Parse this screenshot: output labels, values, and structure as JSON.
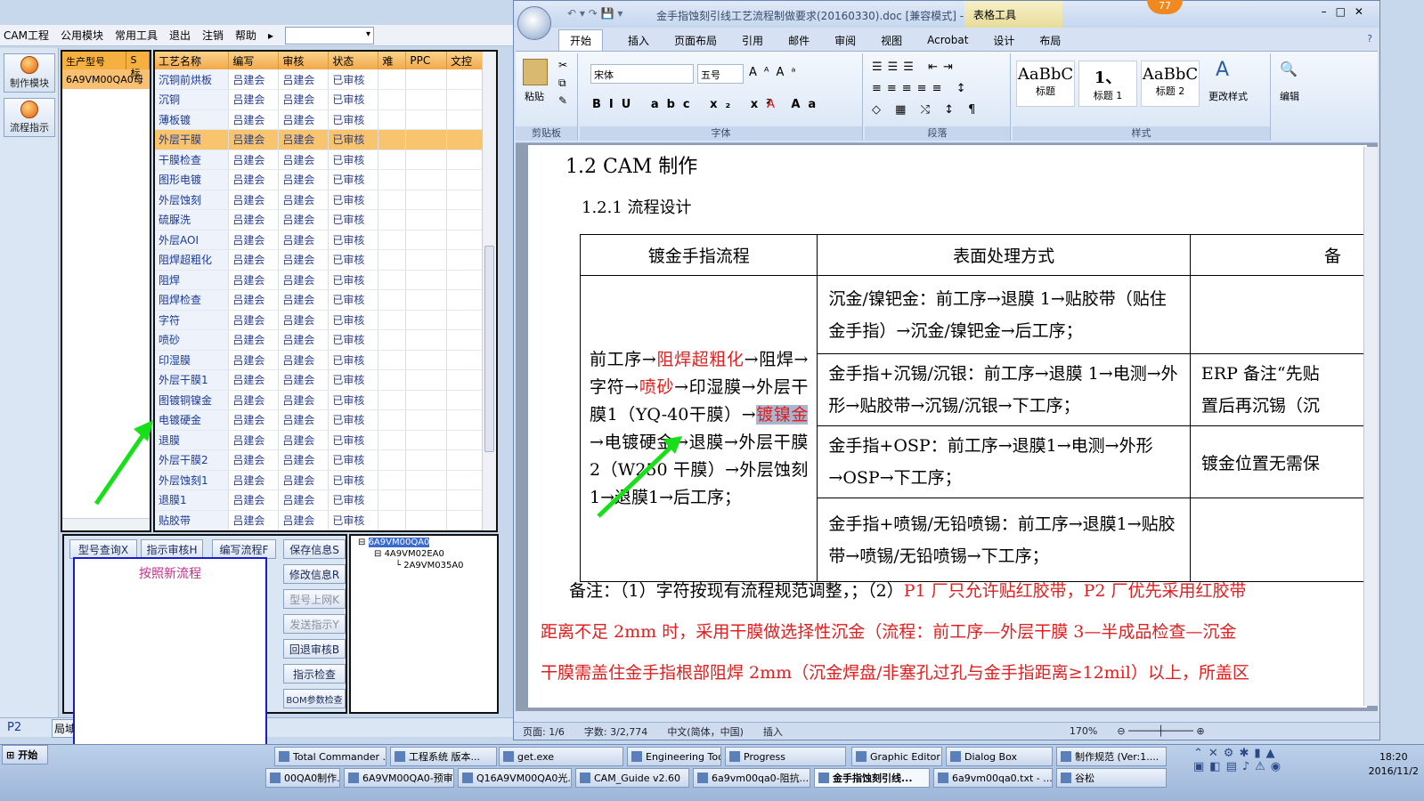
{
  "cam": {
    "menu": [
      "CAM工程",
      "公用模块",
      "常用工具",
      "退出",
      "注销",
      "帮助"
    ],
    "side_buttons": [
      "制作模块",
      "流程指示"
    ],
    "model_panel": {
      "headers": [
        "生产型号",
        "S标"
      ],
      "row": [
        "6A9VM00QA0",
        "母"
      ]
    },
    "proc_headers": [
      "工艺名称",
      "编写",
      "审核",
      "状态",
      "难",
      "PPC",
      "文控"
    ],
    "proc_rows": [
      [
        "沉铜前烘板",
        "吕建会",
        "吕建会",
        "已审核"
      ],
      [
        "沉铜",
        "吕建会",
        "吕建会",
        "已审核"
      ],
      [
        "薄板镀",
        "吕建会",
        "吕建会",
        "已审核"
      ],
      [
        "外层干膜",
        "吕建会",
        "吕建会",
        "已审核"
      ],
      [
        "干膜检查",
        "吕建会",
        "吕建会",
        "已审核"
      ],
      [
        "图形电镀",
        "吕建会",
        "吕建会",
        "已审核"
      ],
      [
        "外层蚀刻",
        "吕建会",
        "吕建会",
        "已审核"
      ],
      [
        "硫脲洗",
        "吕建会",
        "吕建会",
        "已审核"
      ],
      [
        "外层AOI",
        "吕建会",
        "吕建会",
        "已审核"
      ],
      [
        "阻焊超粗化",
        "吕建会",
        "吕建会",
        "已审核"
      ],
      [
        "阻焊",
        "吕建会",
        "吕建会",
        "已审核"
      ],
      [
        "阻焊检查",
        "吕建会",
        "吕建会",
        "已审核"
      ],
      [
        "字符",
        "吕建会",
        "吕建会",
        "已审核"
      ],
      [
        "喷砂",
        "吕建会",
        "吕建会",
        "已审核"
      ],
      [
        "印湿膜",
        "吕建会",
        "吕建会",
        "已审核"
      ],
      [
        "外层干膜1",
        "吕建会",
        "吕建会",
        "已审核"
      ],
      [
        "图镀铜镍金",
        "吕建会",
        "吕建会",
        "已审核"
      ],
      [
        "电镀硬金",
        "吕建会",
        "吕建会",
        "已审核"
      ],
      [
        "退膜",
        "吕建会",
        "吕建会",
        "已审核"
      ],
      [
        "外层干膜2",
        "吕建会",
        "吕建会",
        "已审核"
      ],
      [
        "外层蚀刻1",
        "吕建会",
        "吕建会",
        "已审核"
      ],
      [
        "退膜1",
        "吕建会",
        "吕建会",
        "已审核"
      ],
      [
        "贴胶带",
        "吕建会",
        "吕建会",
        "已审核"
      ]
    ],
    "buttons": {
      "b1": "型号查询X",
      "b2": "指示审核H",
      "b3": "编写流程F",
      "b4": "保存信息S",
      "b5": "修改信息R",
      "b6": "型号上网K",
      "b7": "发送指示Y",
      "b8": "回退审核B",
      "b9": "指示检查",
      "b10": "BOM参数检查"
    },
    "tree": [
      "6A9VM00QA0",
      "4A9VM02EA0",
      "2A9VM035A0"
    ],
    "note_text": "按照新流程",
    "status_left": "P2",
    "status_tab": "局域"
  },
  "word": {
    "title": "金手指蚀刻引线工艺流程制做要求(20160330).doc [兼容模式] -",
    "table_tools": "表格工具",
    "badge": "77",
    "tabs": [
      "开始",
      "插入",
      "页面布局",
      "引用",
      "邮件",
      "审阅",
      "视图",
      "Acrobat",
      "设计",
      "布局"
    ],
    "ribbon": {
      "clipboard": "剪贴板",
      "paste": "粘贴",
      "font": "字体",
      "font_name": "宋体",
      "font_size": "五号",
      "paragraph": "段落",
      "styles": "样式",
      "style1_sample": "AaBbC",
      "style1": "标题",
      "style2_sample": "1、",
      "style2": "标题 1",
      "style3_sample": "AaBbC",
      "style3": "标题 2",
      "change_styles": "更改样式",
      "edit": "编辑"
    },
    "doc": {
      "h2": "1.2   CAM 制作",
      "h3": "1.2.1 流程设计",
      "col1": "镀金手指流程",
      "col2": "表面处理方式",
      "flow": {
        "p1": "前工序→",
        "r1": "阻焊超粗化",
        "p2": "→阻焊→字符→",
        "r2": "喷砂",
        "p3": "→印湿膜→外层干膜1（YQ-40干膜）→",
        "r3": "镀镍金",
        "p4": "→电镀硬金→退膜→外层干膜 2（W250 干膜）→外层蚀刻1→退膜1→后工序；"
      },
      "cells": [
        "沉金/镍钯金：前工序→退膜 1→贴胶带（贴住金手指）→沉金/镍钯金→后工序；",
        "金手指+沉锡/沉银：前工序→退膜 1→电测→外形→贴胶带→沉锡/沉银→下工序；",
        "金手指+OSP：前工序→退膜1→电测→外形→OSP→下工序；",
        "金手指+喷锡/无铅喷锡：前工序→退膜1→贴胶带→喷锡/无铅喷锡→下工序；"
      ],
      "col3": [
        "ERP 备注“先贴",
        "置后再沉锡（沉",
        "镀金位置无需保"
      ],
      "note1a": "备注：（1）字符按现有流程规范调整，；（2）",
      "note1b": "P1 厂只允许贴红胶带，P2 厂优先采用红胶带",
      "note2": "距离不足 2mm 时，采用干膜做选择性沉金（流程：前工序—外层干膜 3—半成品检查—沉金",
      "note3": "干膜需盖住金手指根部阻焊 2mm（沉金焊盘/非塞孔过孔与金手指距离≥12mil）以上，所盖区"
    },
    "status": [
      "页面: 1/6",
      "字数: 3/2,774",
      "中文(简体，中国)",
      "插入",
      "170%"
    ]
  },
  "taskbar": {
    "start": "开始",
    "row1": [
      "Total Commander ...",
      "工程系统  版本...",
      "get.exe",
      "Engineering Toolki...",
      "Progress",
      "Graphic Editor 9.0...",
      "Dialog Box",
      "制作规范 (Ver:1...."
    ],
    "row2": [
      "00QA0制作...",
      "6A9VM00QA0-预审...",
      "Q16A9VM00QA0光...",
      "CAM_Guide v2.60",
      "6a9vm00qa0-阻抗...",
      "金手指蚀刻引线...",
      "6a9vm00qa0.txt - ...",
      "谷松"
    ],
    "time": "18:20",
    "date": "2016/11/2"
  }
}
